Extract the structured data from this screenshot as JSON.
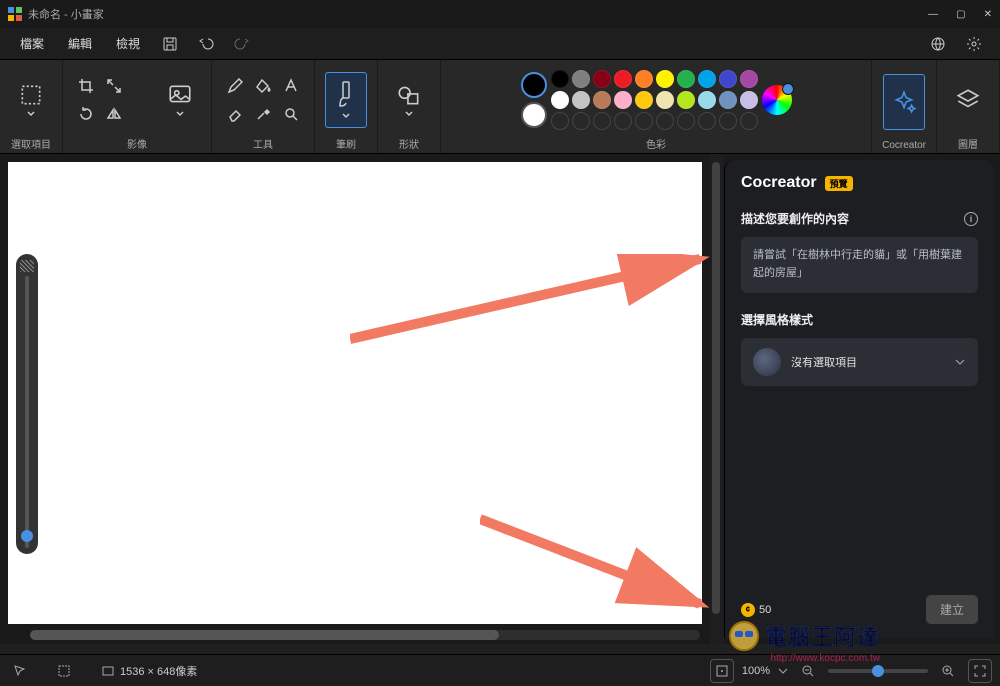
{
  "window": {
    "title": "未命名 - 小畫家"
  },
  "menus": {
    "file": "檔案",
    "edit": "編輯",
    "view": "檢視"
  },
  "ribbon_groups": {
    "selection": "選取項目",
    "image": "影像",
    "tools": "工具",
    "brushes": "筆刷",
    "shapes": "形狀",
    "colors": "色彩",
    "cocreator": "Cocreator",
    "layers": "圖層"
  },
  "palette": {
    "primary": "#000000",
    "secondary": "#ffffff",
    "colors_row1": [
      "#000000",
      "#7f7f7f",
      "#880015",
      "#ed1c24",
      "#ff7f27",
      "#fff200",
      "#22b14c",
      "#00a2e8",
      "#3f48cc",
      "#a349a4"
    ],
    "colors_row2": [
      "#ffffff",
      "#c3c3c3",
      "#b97a57",
      "#ffaec9",
      "#ffc90e",
      "#efe4b0",
      "#b5e61d",
      "#99d9ea",
      "#7092be",
      "#c8bfe7"
    ],
    "blank_slots": 10
  },
  "cocreator": {
    "title": "Cocreator",
    "badge": "預覽",
    "describe_label": "描述您要創作的內容",
    "prompt_placeholder": "請嘗試「在樹林中行走的貓」或「用樹葉建起的房屋」",
    "style_label": "選擇風格樣式",
    "style_value": "沒有選取項目",
    "credits": "50",
    "generate": "建立"
  },
  "status": {
    "cursor_pos": "",
    "selection": "",
    "canvas_size": "1536 × 648像素",
    "zoom": "100%"
  },
  "watermark": {
    "name": "電腦王阿達",
    "url": "http://www.kocpc.com.tw"
  }
}
